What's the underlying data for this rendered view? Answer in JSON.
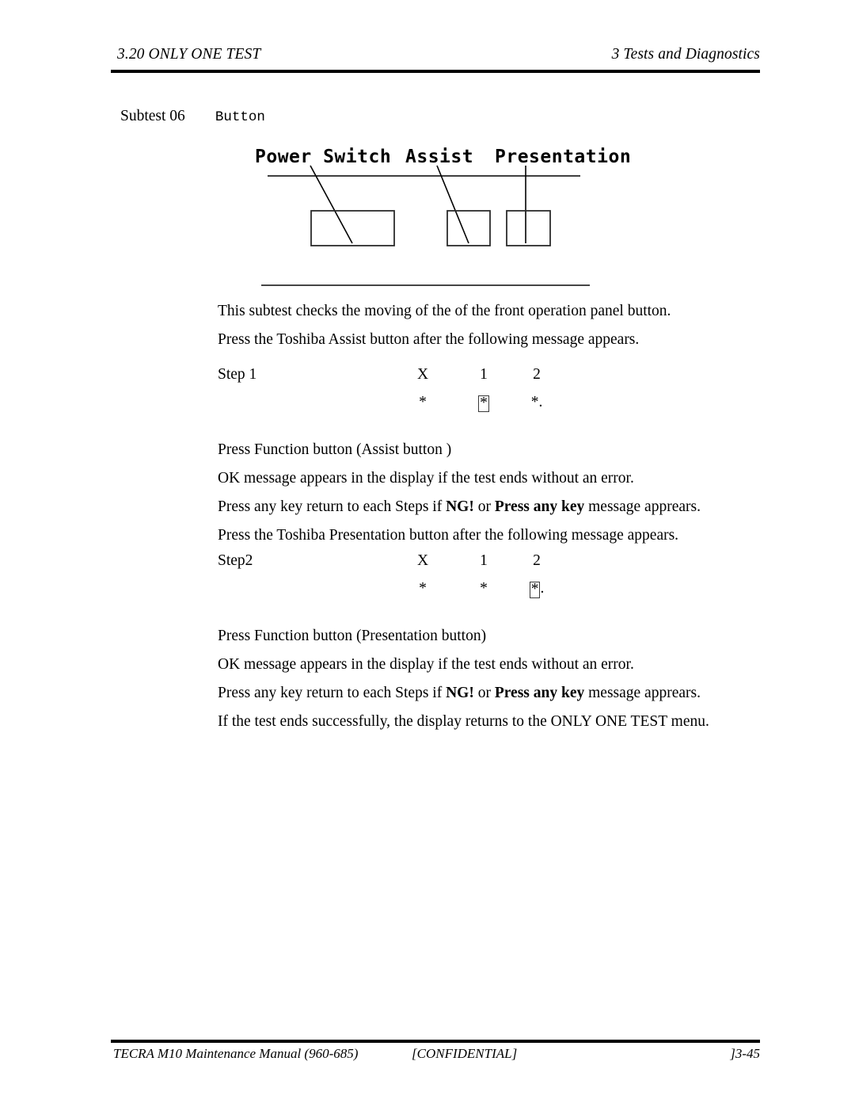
{
  "header": {
    "section": "3.20 ONLY ONE TEST",
    "chapter": "3 Tests and Diagnostics"
  },
  "subtest": {
    "label": "Subtest 06",
    "name": "Button"
  },
  "figure": {
    "labels": {
      "power_switch": "Power Switch",
      "assist": "Assist",
      "presentation": "Presentation"
    }
  },
  "body": {
    "intro_1": "This subtest checks the moving of the of the front operation panel button.",
    "intro_2": "Press the Toshiba Assist  button after the following message appears.",
    "after_step1_1": "Press Function button (Assist  button )",
    "after_step1_2": "OK message appears in the display if the test ends without an error.",
    "after_step1_3_a": "Press any key return to each Steps if ",
    "after_step1_3_ng": "NG!",
    "after_step1_3_b": " or ",
    "after_step1_3_key": "Press any key",
    "after_step1_3_c": " message apprears.",
    "after_step1_4": "Press the Toshiba Presentation button after the following message appears.",
    "after_step2_1": "Press Function button (Presentation button)",
    "after_step2_2": "OK message appears in the display if the test ends without an error.",
    "after_step2_3_a": "Press any key return to each Steps if ",
    "after_step2_3_ng": "NG!",
    "after_step2_3_b": " or ",
    "after_step2_3_key": "Press any key",
    "after_step2_3_c": " message apprears.",
    "after_step2_4": "If the test ends successfully, the display returns to the ONLY ONE TEST menu."
  },
  "step1": {
    "name": "Step 1",
    "columns": [
      "X",
      "1",
      "2"
    ],
    "stars": [
      "*",
      "*",
      "*"
    ],
    "boxed_index": 1,
    "trailing": "."
  },
  "step2": {
    "name": "Step2",
    "columns": [
      "X",
      "1",
      "2"
    ],
    "stars": [
      "*",
      "*",
      "*"
    ],
    "boxed_index": 2,
    "trailing": "."
  },
  "footer": {
    "left": "TECRA M10 Maintenance Manual (960-685)",
    "middle": "[CONFIDENTIAL]",
    "right": "]3-45"
  }
}
